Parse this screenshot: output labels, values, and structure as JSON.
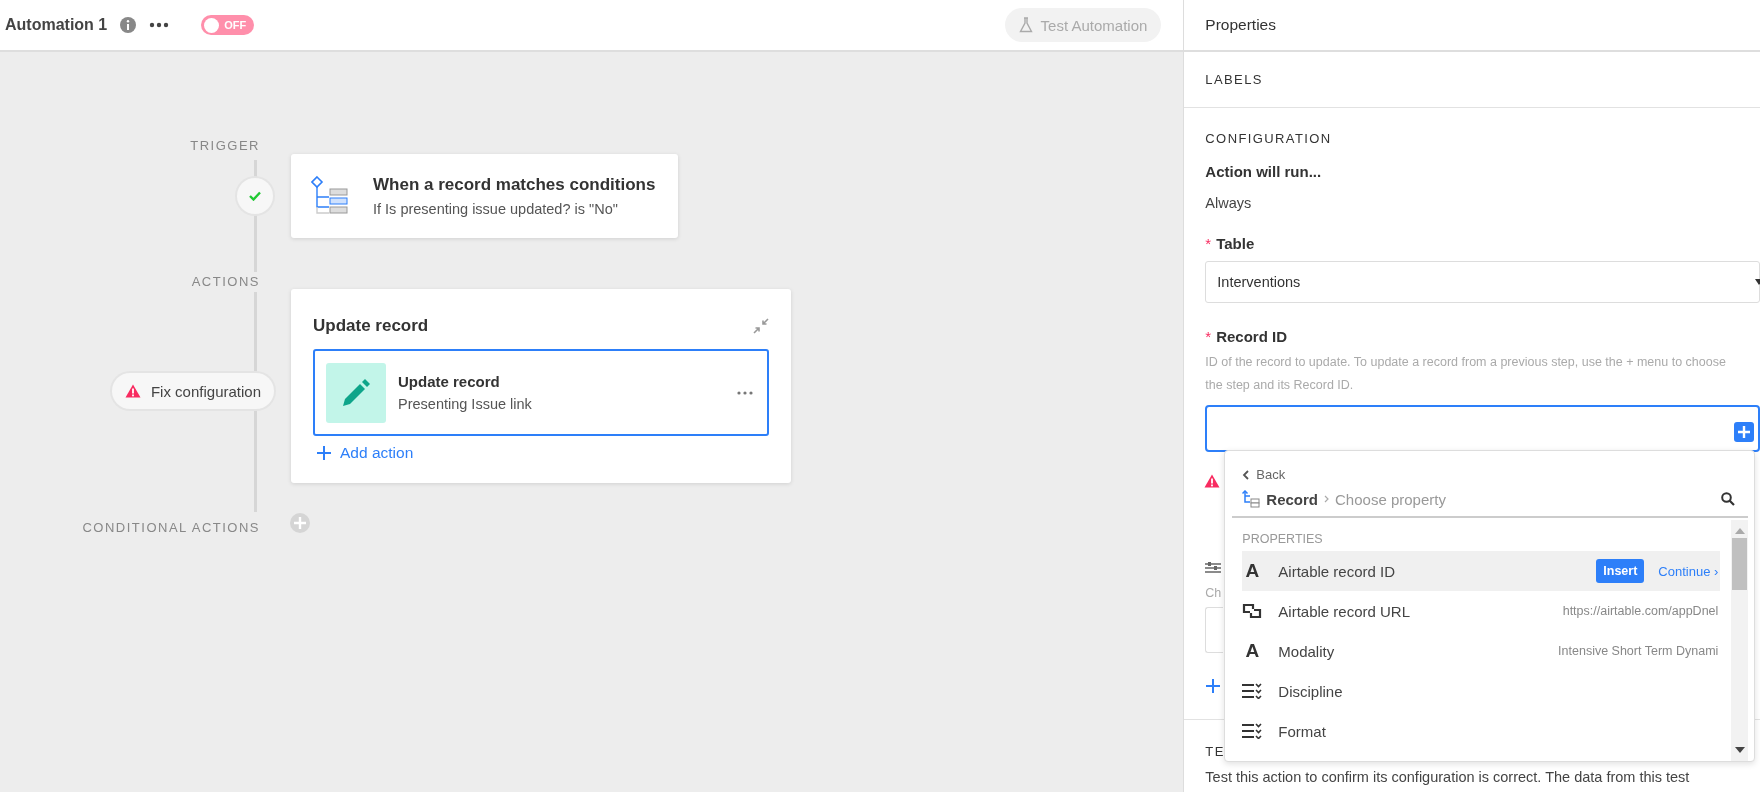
{
  "header": {
    "title": "Automation 1",
    "toggle": {
      "label": "OFF",
      "on": false
    },
    "test_button": "Test Automation"
  },
  "canvas": {
    "trigger_label": "TRIGGER",
    "trigger": {
      "title": "When a record matches conditions",
      "subtitle": "If Is presenting issue updated? is \"No\"",
      "done": true
    },
    "actions_label": "ACTIONS",
    "action_group": {
      "title": "Update record",
      "status": "Fix configuration",
      "add_label": "Add action",
      "steps": [
        {
          "title": "Update record",
          "subtitle": "Presenting Issue link",
          "selected": true
        }
      ]
    },
    "conditional_label": "CONDITIONAL ACTIONS"
  },
  "properties": {
    "title": "Properties",
    "labels_heading": "LABELS",
    "config_heading": "CONFIGURATION",
    "run_label": "Action will run...",
    "run_value": "Always",
    "table": {
      "label": "Table",
      "required": true,
      "required_mark": "*",
      "value": "Interventions"
    },
    "record_id": {
      "label": "Record ID",
      "required": true,
      "required_mark": "*",
      "help": "ID of the record to update. To update a record from a previous step, use the + menu to choose the step and its Record ID.",
      "focused": true
    },
    "hidden_hint": "Ch",
    "test_heading": "TE",
    "test_text": "Test this action to confirm its configuration is correct. The data from this test"
  },
  "picker": {
    "back": "Back",
    "root": "Record",
    "current": "Choose property",
    "section": "PROPERTIES",
    "items": [
      {
        "kind": "text",
        "glyph": "A",
        "name": "Airtable record ID",
        "selected": true,
        "insert": "Insert",
        "continue": "Continue ›"
      },
      {
        "kind": "link",
        "name": "Airtable record URL",
        "preview": "https://airtable.com/appDnel",
        "selected": false
      },
      {
        "kind": "text",
        "glyph": "A",
        "name": "Modality",
        "preview": "Intensive Short Term Dynami",
        "selected": false
      },
      {
        "kind": "select",
        "name": "Discipline",
        "selected": false
      },
      {
        "kind": "select",
        "name": "Format",
        "selected": false
      }
    ]
  }
}
